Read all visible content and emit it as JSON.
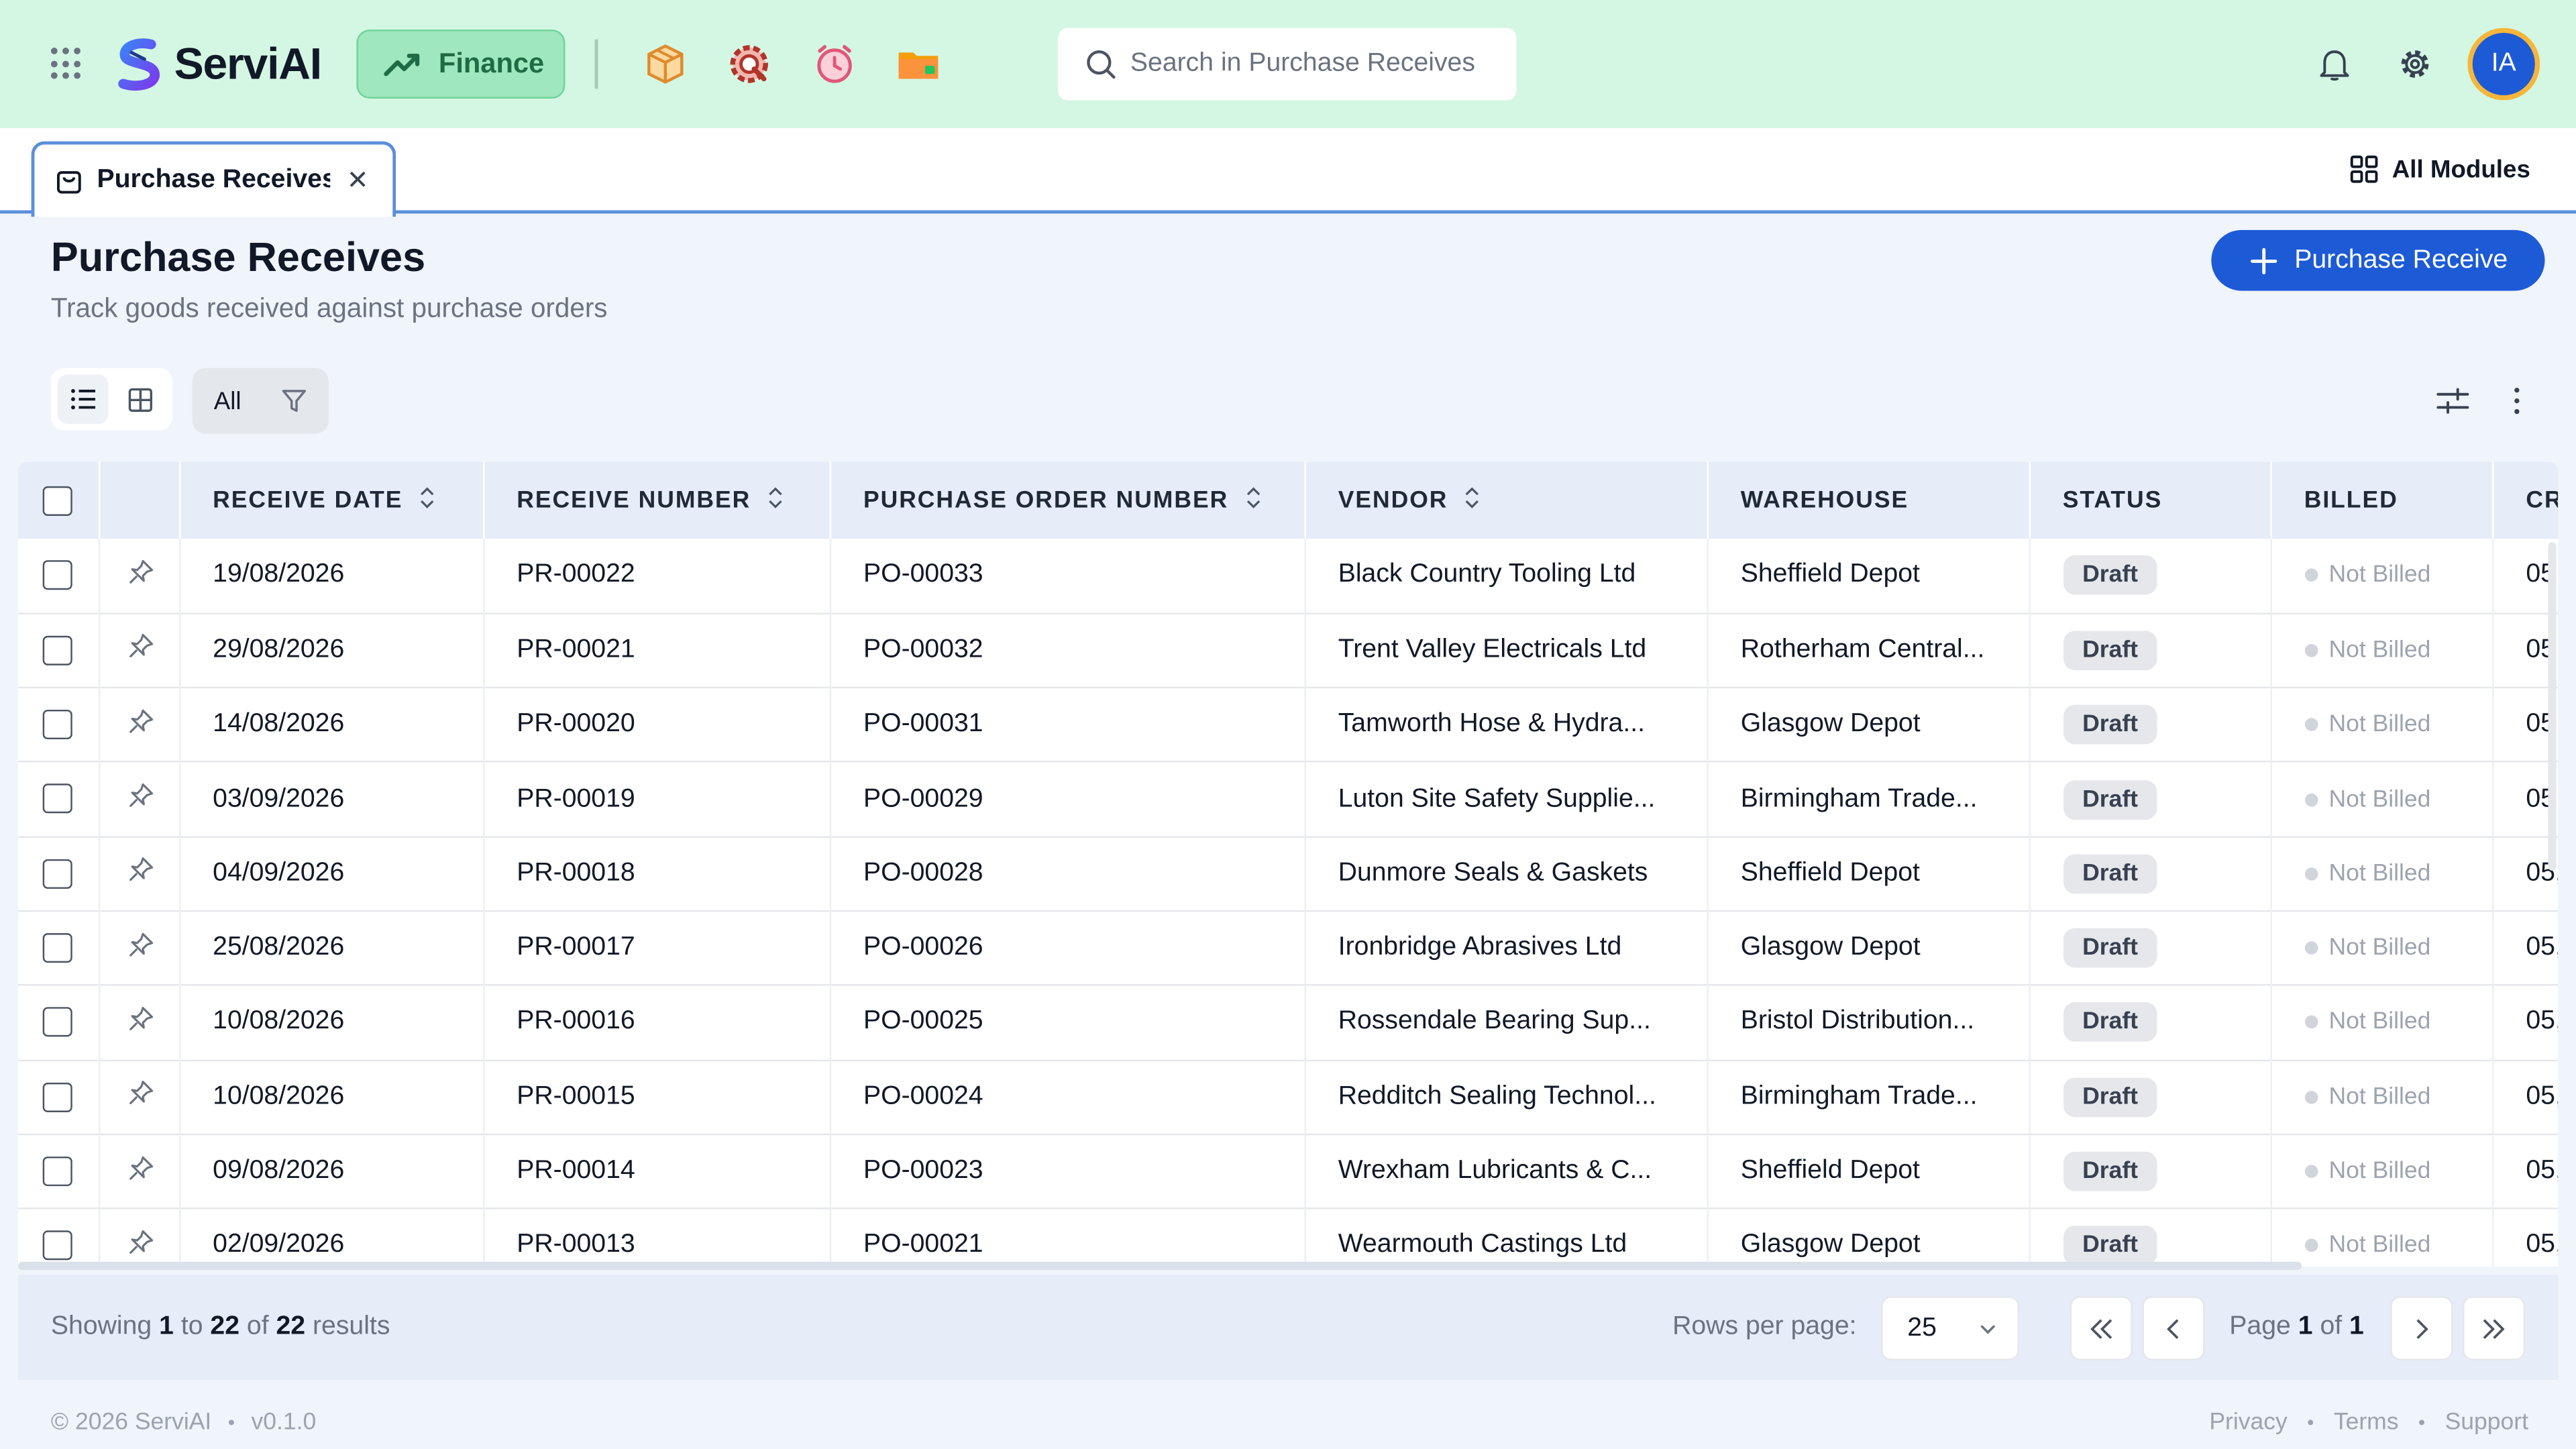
{
  "header": {
    "app_name": "ServiAI",
    "module": "Finance",
    "search_placeholder": "Search in Purchase Receives",
    "avatar_initials": "IA",
    "brand_color": "#1d5ad6",
    "header_bg": "#d4f7e3"
  },
  "tabs": {
    "active_tab": "Purchase Receives",
    "all_modules": "All Modules"
  },
  "page": {
    "title": "Purchase Receives",
    "subtitle": "Track goods received against purchase orders",
    "new_button": "Purchase Receive"
  },
  "toolbar": {
    "filter_all": "All"
  },
  "table": {
    "columns": [
      "RECEIVE DATE",
      "RECEIVE NUMBER",
      "PURCHASE ORDER NUMBER",
      "VENDOR",
      "WAREHOUSE",
      "STATUS",
      "BILLED",
      "CR"
    ],
    "rows": [
      {
        "date": "19/08/2026",
        "rnum": "PR-00022",
        "po": "PO-00033",
        "vendor": "Black Country Tooling Ltd",
        "warehouse": "Sheffield Depot",
        "status": "Draft",
        "billed": "Not Billed",
        "cr": "05"
      },
      {
        "date": "29/08/2026",
        "rnum": "PR-00021",
        "po": "PO-00032",
        "vendor": "Trent Valley Electricals Ltd",
        "warehouse": "Rotherham Central...",
        "status": "Draft",
        "billed": "Not Billed",
        "cr": "05"
      },
      {
        "date": "14/08/2026",
        "rnum": "PR-00020",
        "po": "PO-00031",
        "vendor": "Tamworth Hose & Hydra...",
        "warehouse": "Glasgow Depot",
        "status": "Draft",
        "billed": "Not Billed",
        "cr": "05"
      },
      {
        "date": "03/09/2026",
        "rnum": "PR-00019",
        "po": "PO-00029",
        "vendor": "Luton Site Safety Supplie...",
        "warehouse": "Birmingham Trade...",
        "status": "Draft",
        "billed": "Not Billed",
        "cr": "05"
      },
      {
        "date": "04/09/2026",
        "rnum": "PR-00018",
        "po": "PO-00028",
        "vendor": "Dunmore Seals & Gaskets",
        "warehouse": "Sheffield Depot",
        "status": "Draft",
        "billed": "Not Billed",
        "cr": "05,"
      },
      {
        "date": "25/08/2026",
        "rnum": "PR-00017",
        "po": "PO-00026",
        "vendor": "Ironbridge Abrasives Ltd",
        "warehouse": "Glasgow Depot",
        "status": "Draft",
        "billed": "Not Billed",
        "cr": "05,"
      },
      {
        "date": "10/08/2026",
        "rnum": "PR-00016",
        "po": "PO-00025",
        "vendor": "Rossendale Bearing Sup...",
        "warehouse": "Bristol Distribution...",
        "status": "Draft",
        "billed": "Not Billed",
        "cr": "05,"
      },
      {
        "date": "10/08/2026",
        "rnum": "PR-00015",
        "po": "PO-00024",
        "vendor": "Redditch Sealing Technol...",
        "warehouse": "Birmingham Trade...",
        "status": "Draft",
        "billed": "Not Billed",
        "cr": "05,"
      },
      {
        "date": "09/08/2026",
        "rnum": "PR-00014",
        "po": "PO-00023",
        "vendor": "Wrexham Lubricants & C...",
        "warehouse": "Sheffield Depot",
        "status": "Draft",
        "billed": "Not Billed",
        "cr": "05,"
      },
      {
        "date": "02/09/2026",
        "rnum": "PR-00013",
        "po": "PO-00021",
        "vendor": "Wearmouth Castings Ltd",
        "warehouse": "Glasgow Depot",
        "status": "Draft",
        "billed": "Not Billed",
        "cr": "05,"
      }
    ]
  },
  "pagination": {
    "showing_prefix": "Showing",
    "from": "1",
    "to_word": "to",
    "to": "22",
    "of_word": "of",
    "total": "22",
    "results_word": "results",
    "rows_per_page_label": "Rows per page:",
    "rows_per_page": "25",
    "page_word": "Page",
    "page": "1",
    "page_of": "of",
    "page_total": "1"
  },
  "footer": {
    "copyright": "© 2026 ServiAI",
    "version": "v0.1.0",
    "links": [
      "Privacy",
      "Terms",
      "Support"
    ]
  }
}
